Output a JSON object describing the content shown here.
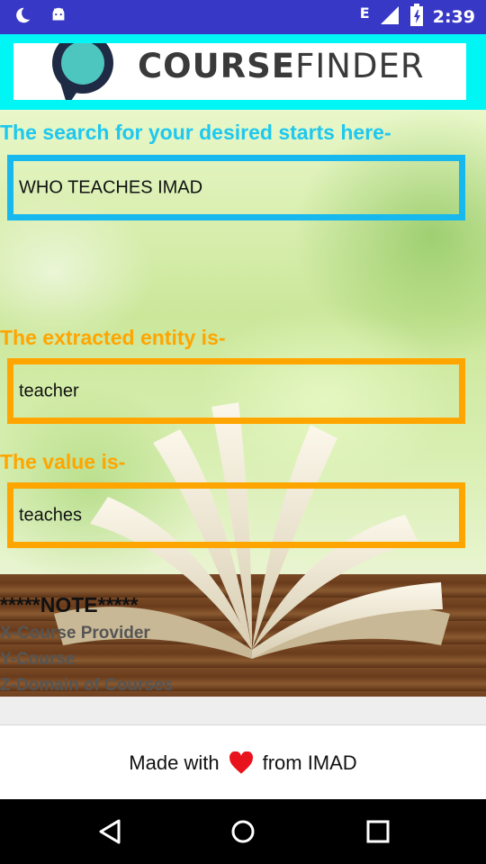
{
  "status_bar": {
    "time": "2:39",
    "network_letter": "E",
    "icons": [
      "moon-icon",
      "android-icon",
      "signal-icon",
      "battery-icon"
    ]
  },
  "header": {
    "logo_text_bold": "COURSE",
    "logo_text_rest": "FINDER"
  },
  "search": {
    "label": "The search for your desired starts here-",
    "value": "WHO TEACHES IMAD"
  },
  "entity": {
    "label": "The extracted entity is-",
    "value": "teacher"
  },
  "value_section": {
    "label": "The value is-",
    "value": "teaches"
  },
  "note": {
    "title": "*****NOTE*****",
    "lines": [
      "X-Course Provider",
      "Y-Course",
      "Z-Domain of Courses"
    ]
  },
  "footer": {
    "prefix": "Made with",
    "suffix": "from IMAD"
  },
  "colors": {
    "status_bar": "#3838c6",
    "header_bg": "#00f5f5",
    "blue_accent": "#16b8ee",
    "orange_accent": "#ffa500",
    "heart": "#e8131c"
  },
  "nav": {
    "buttons": [
      "back-icon",
      "home-icon",
      "recents-icon"
    ]
  }
}
